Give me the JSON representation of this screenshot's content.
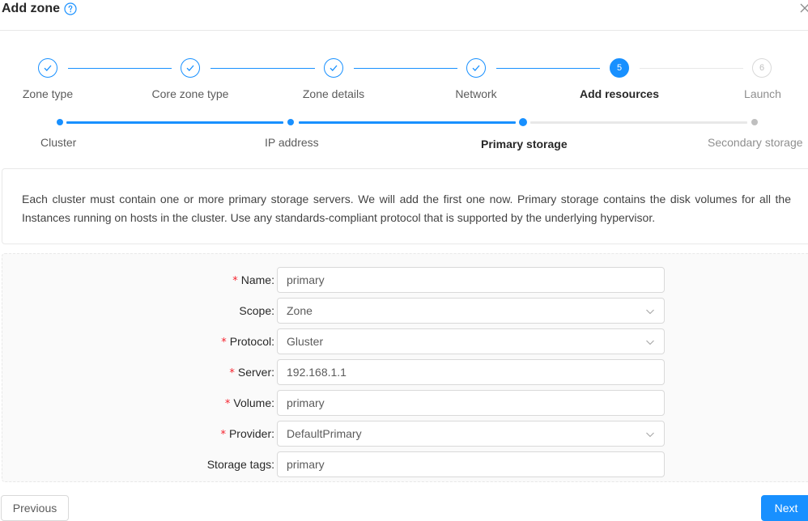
{
  "modal": {
    "title": "Add zone"
  },
  "steps": [
    {
      "label": "Zone type",
      "status": "finish"
    },
    {
      "label": "Core zone type",
      "status": "finish"
    },
    {
      "label": "Zone details",
      "status": "finish"
    },
    {
      "label": "Network",
      "status": "finish"
    },
    {
      "label": "Add resources",
      "status": "process",
      "number": "5"
    },
    {
      "label": "Launch",
      "status": "wait",
      "number": "6"
    }
  ],
  "substeps": [
    {
      "label": "Cluster",
      "status": "finish"
    },
    {
      "label": "IP address",
      "status": "finish"
    },
    {
      "label": "Primary storage",
      "status": "process"
    },
    {
      "label": "Secondary storage",
      "status": "wait"
    }
  ],
  "description": "Each cluster must contain one or more primary storage servers. We will add the first one now. Primary storage contains the disk volumes for all the Instances running on hosts in the cluster. Use any standards-compliant protocol that is supported by the underlying hypervisor.",
  "form": {
    "name": {
      "label": "Name",
      "value": "primary",
      "required": true
    },
    "scope": {
      "label": "Scope",
      "value": "Zone",
      "required": false
    },
    "protocol": {
      "label": "Protocol",
      "value": "Gluster",
      "required": true
    },
    "server": {
      "label": "Server",
      "value": "192.168.1.1",
      "required": true
    },
    "volume": {
      "label": "Volume",
      "value": "primary",
      "required": true
    },
    "provider": {
      "label": "Provider",
      "value": "DefaultPrimary",
      "required": true
    },
    "storage_tags": {
      "label": "Storage tags",
      "value": "primary",
      "required": false
    }
  },
  "footer": {
    "previous_label": "Previous",
    "next_label": "Next"
  },
  "colors": {
    "primary": "#1890ff",
    "required": "#f5222d",
    "border": "#d9d9d9"
  },
  "icons": {
    "help": "question-circle-icon",
    "close": "close-icon",
    "check": "check-icon",
    "select": "chevron-down-icon"
  }
}
